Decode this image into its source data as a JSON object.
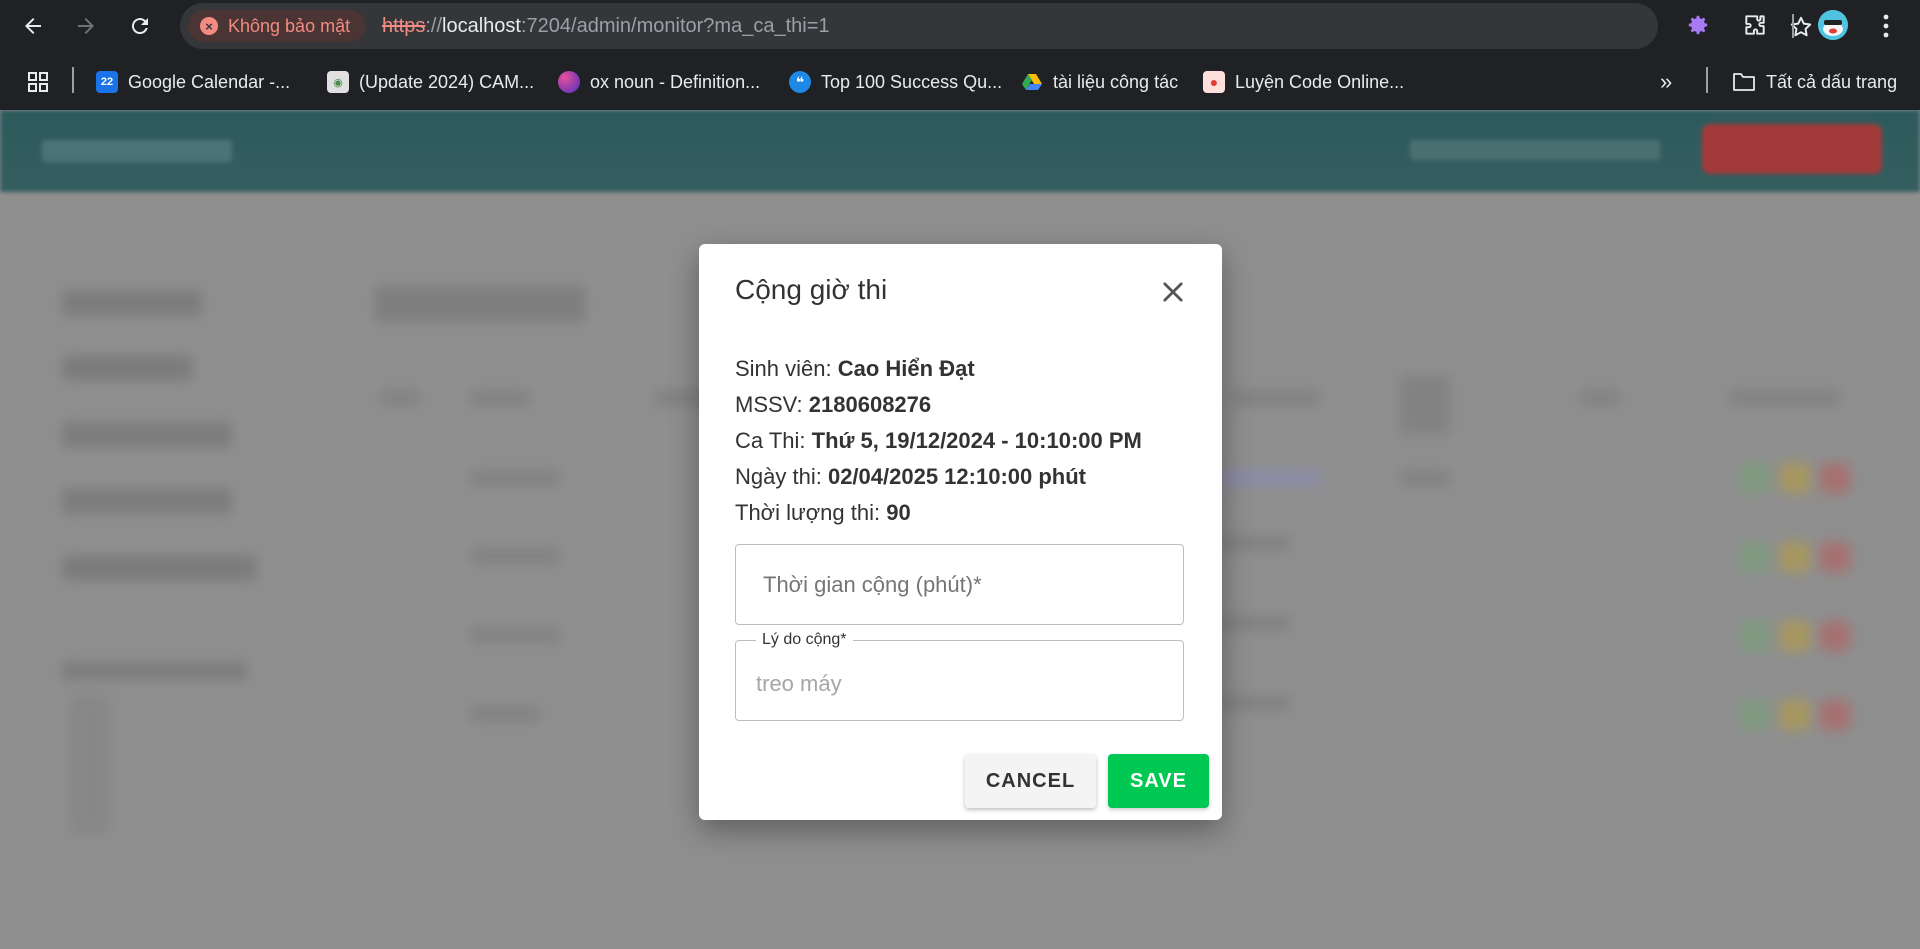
{
  "browser": {
    "security_label": "Không bảo mật",
    "url_scheme": "https",
    "url_sep": "://",
    "url_host": "localhost",
    "url_rest": ":7204/admin/monitor?ma_ca_thi=1",
    "bookmarks": [
      {
        "label": "Google Calendar -...",
        "icon": "calendar-icon",
        "color": "#1a73e8"
      },
      {
        "label": "(Update 2024) CAM...",
        "icon": "cam-icon",
        "color": "#e0e0e0"
      },
      {
        "label": "ox noun - Definition...",
        "icon": "oxford-icon",
        "color": "#6a3fbf"
      },
      {
        "label": "Top 100 Success Qu...",
        "icon": "quote-icon",
        "color": "#1e88e5"
      },
      {
        "label": "tài liệu công tác",
        "icon": "drive-icon",
        "color": "#34a853"
      },
      {
        "label": "Luyện Code Online...",
        "icon": "code-icon",
        "color": "#e53935"
      }
    ],
    "all_bookmarks_label": "Tất cả dấu trang"
  },
  "modal": {
    "title": "Cộng giờ thi",
    "student_label": "Sinh viên:",
    "student_value": "Cao Hiển Đạt",
    "mssv_label": "MSSV:",
    "mssv_value": "2180608276",
    "session_label": "Ca Thi:",
    "session_value": "Thứ 5, 19/12/2024 - 10:10:00 PM",
    "date_label": "Ngày thi:",
    "date_value": "02/04/2025 12:10:00 phút",
    "duration_label": "Thời lượng thi:",
    "duration_value": "90",
    "add_time_placeholder": "Thời gian cộng (phút)*",
    "reason_label": "Lý do cộng*",
    "reason_placeholder": "treo máy",
    "cancel_label": "CANCEL",
    "save_label": "SAVE"
  },
  "colors": {
    "save": "#00c853",
    "header": "#2d5a5c",
    "danger": "#f28b82"
  }
}
